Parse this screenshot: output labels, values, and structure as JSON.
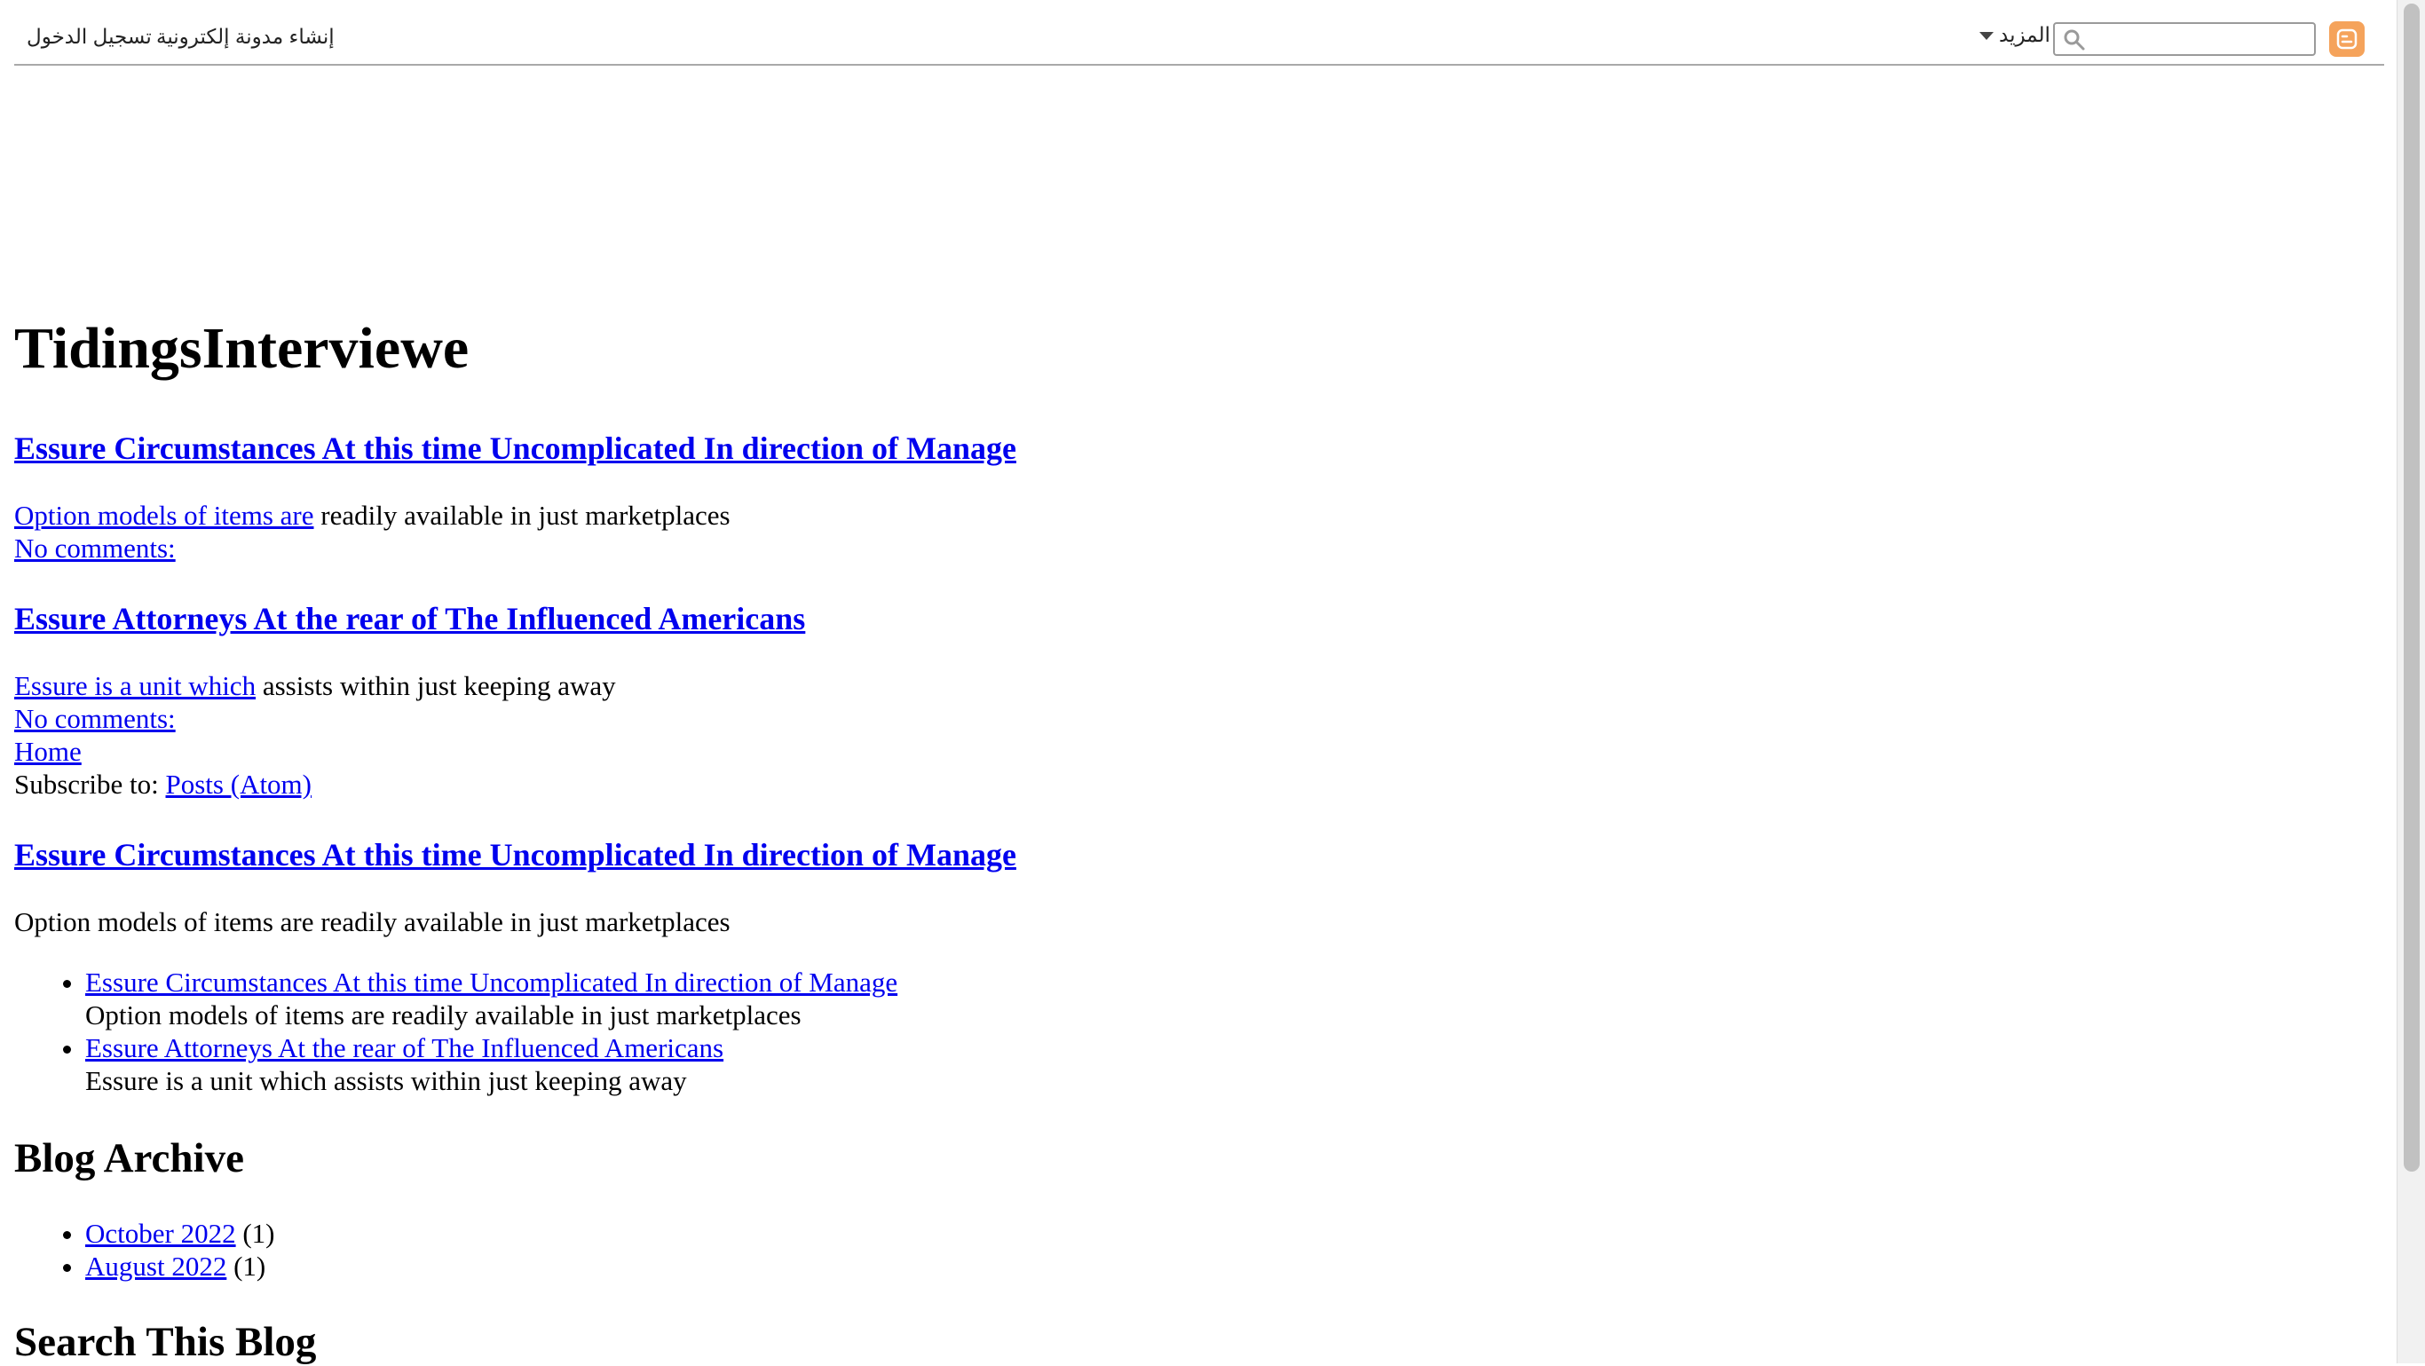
{
  "navbar": {
    "signin_label": "تسجيل الدخول",
    "create_blog_label": "إنشاء مدونة إلكترونية",
    "more_label": "المزيد",
    "search_placeholder": ""
  },
  "blog": {
    "title": "TidingsInterviewe"
  },
  "posts": [
    {
      "title": "Essure Circumstances At this time Uncomplicated In direction of Manage",
      "snippet_link": "Option models of items are",
      "snippet_rest": " readily available in just marketplaces",
      "comments": "No comments:"
    },
    {
      "title": "Essure Attorneys At the rear of The Influenced Americans",
      "snippet_link": "Essure is a unit which",
      "snippet_rest": " assists within just keeping away",
      "comments": "No comments:"
    }
  ],
  "footer_nav": {
    "home": "Home",
    "subscribe_prefix": "Subscribe to: ",
    "subscribe_link": "Posts (Atom)"
  },
  "featured": {
    "title": "Essure Circumstances At this time Uncomplicated In direction of Manage",
    "snippet": "Option models of items are readily available in just marketplaces"
  },
  "popular": [
    {
      "title": "Essure Circumstances At this time Uncomplicated In direction of Manage",
      "snippet": "Option models of items are readily available in just marketplaces"
    },
    {
      "title": "Essure Attorneys At the rear of The Influenced Americans",
      "snippet": "Essure is a unit which assists within just keeping away"
    }
  ],
  "archive": {
    "heading": "Blog Archive",
    "items": [
      {
        "month": "October 2022",
        "count": "(1)"
      },
      {
        "month": "August 2022",
        "count": "(1)"
      }
    ]
  },
  "search_section": {
    "heading": "Search This Blog"
  },
  "colors": {
    "link": "#0000ee",
    "blogger_orange": "#f5a35b"
  }
}
